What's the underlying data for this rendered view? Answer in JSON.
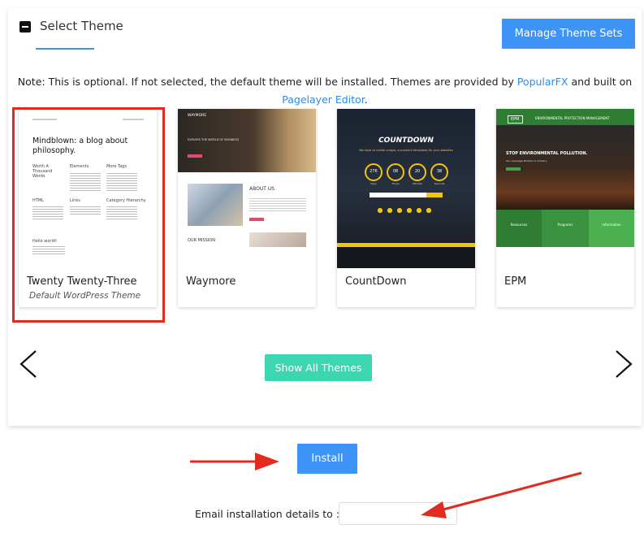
{
  "panel": {
    "title": "Select Theme",
    "manage_button": "Manage Theme Sets",
    "note_prefix": "Note: This is optional. If not selected, the default theme will be installed. Themes are provided by",
    "note_link1": "PopularFX",
    "note_middle": "and built on",
    "note_link2": "Pagelayer Editor",
    "note_suffix": "."
  },
  "themes": [
    {
      "name": "Twenty Twenty-Three",
      "subtitle": "Default WordPress Theme",
      "preview": {
        "heading": "Mindblown: a blog about philosophy.",
        "col1": "Worth A Thousand Words",
        "col2": "Elements",
        "col3": "More Tags",
        "col4": "HTML",
        "col5": "Links",
        "col6": "Category Hierarchy",
        "post": "Hello world!"
      }
    },
    {
      "name": "Waymore",
      "preview": {
        "brand": "WAYMORE",
        "hero": "EXPLORE THE WORLD OF BUSINESS",
        "about": "ABOUT US",
        "mission": "OUR MISSION"
      }
    },
    {
      "name": "CountDown",
      "preview": {
        "title": "COUNTDOWN",
        "subtitle": "We have to create unique, successful templates for your websites",
        "counts": [
          "276",
          "08",
          "20",
          "38"
        ],
        "units": [
          "Days",
          "Hours",
          "Minutes",
          "Seconds"
        ]
      }
    },
    {
      "name": "EPM",
      "preview": {
        "logo": "EPM",
        "header": "ENVIRONMENTAL PROTECTION MANAGEMENT",
        "hero": "STOP ENVIRONMENTAL POLLUTION.",
        "hero_sub": "Our Greenage Brilliant is Industry",
        "tiles": [
          "Resources",
          "Programs",
          "Information"
        ]
      }
    }
  ],
  "buttons": {
    "show_all": "Show All Themes",
    "install": "Install"
  },
  "email": {
    "label": "Email installation details to :",
    "value": ""
  },
  "colors": {
    "primary": "#3d94f6",
    "teal": "#3cd6b0",
    "annotation_red": "#e32a1f"
  }
}
